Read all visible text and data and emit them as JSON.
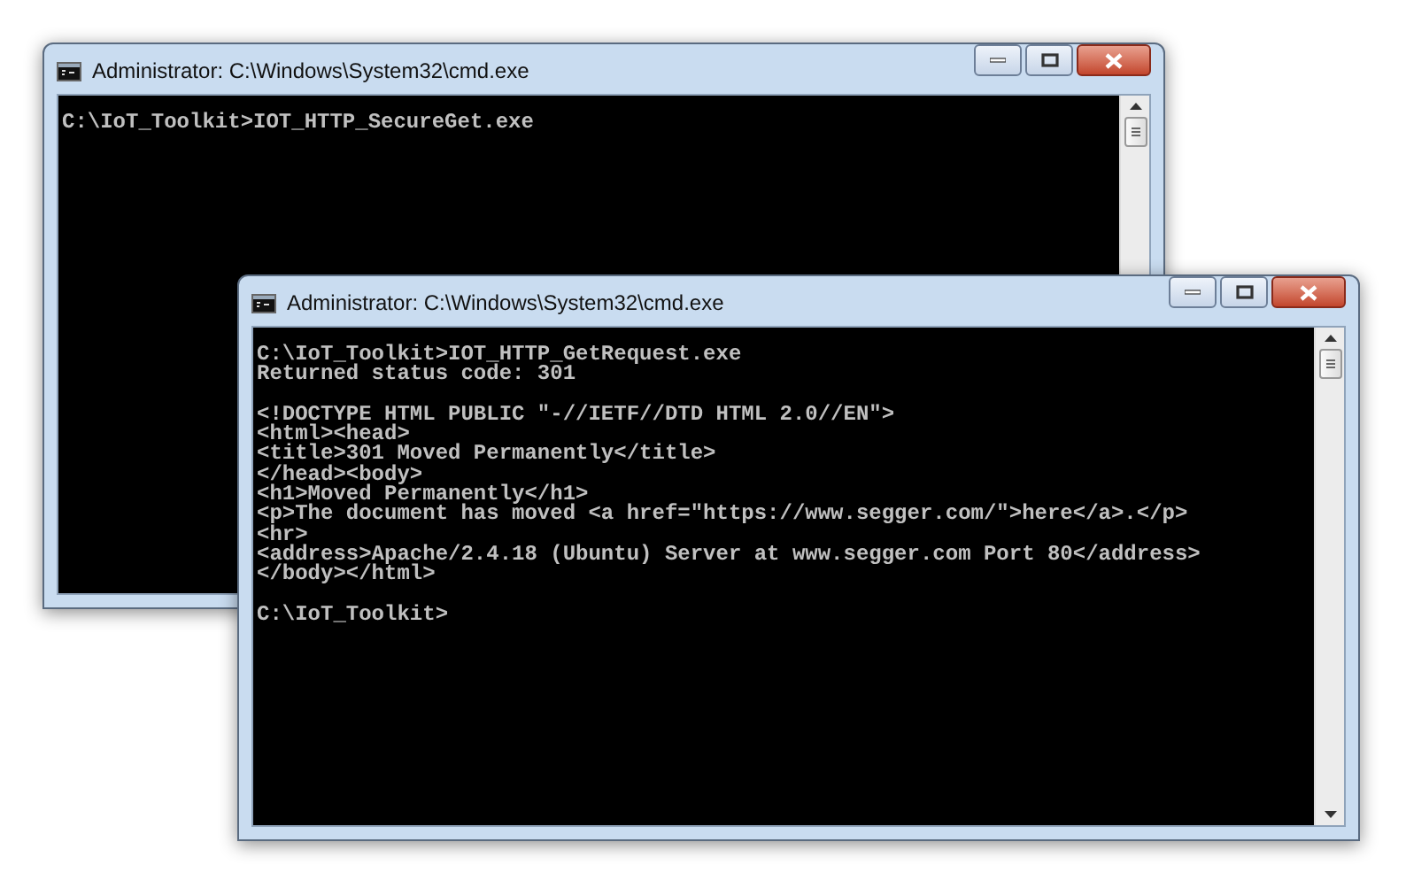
{
  "windows": [
    {
      "title": "Administrator: C:\\Windows\\System32\\cmd.exe",
      "blocks": [
        [
          "C:\\IoT_Toolkit>IOT_HTTP_SecureGet.exe"
        ]
      ]
    },
    {
      "title": "Administrator: C:\\Windows\\System32\\cmd.exe",
      "blocks": [
        [
          "C:\\IoT_Toolkit>IOT_HTTP_GetRequest.exe",
          "Returned status code: 301"
        ],
        [
          "<!DOCTYPE HTML PUBLIC \"-//IETF//DTD HTML 2.0//EN\">",
          "<html><head>",
          "<title>301 Moved Permanently</title>",
          "</head><body>",
          "<h1>Moved Permanently</h1>",
          "<p>The document has moved <a href=\"https://www.segger.com/\">here</a>.</p>",
          "<hr>",
          "<address>Apache/2.4.18 (Ubuntu) Server at www.segger.com Port 80</address>",
          "</body></html>"
        ],
        [
          "C:\\IoT_Toolkit>"
        ]
      ]
    }
  ]
}
